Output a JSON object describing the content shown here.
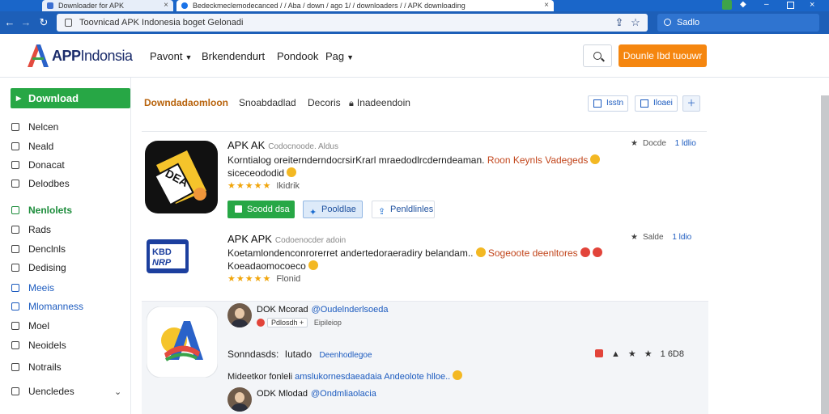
{
  "browser": {
    "tabs": [
      {
        "title": "Downloader for APK"
      },
      {
        "title": "Bedeckmeclemodecanced / / Aba / down / ago 1/ / downloaders / / APK downloading"
      }
    ],
    "url": "Toovnicad APK Indonesia boget Gelonadi",
    "search_placeholder": "Sadlo"
  },
  "site": {
    "logo": {
      "bold": "APP",
      "light": "Indonsia"
    },
    "nav": [
      {
        "label": "Pavont",
        "caret": true
      },
      {
        "label": "Brkendendurt",
        "caret": false
      },
      {
        "label": "Pondook",
        "caret": false
      },
      {
        "label": "Pag",
        "caret": true
      }
    ],
    "cta_label": "Dounle Ibd tuouwr"
  },
  "sidebar": {
    "download_label": "Download",
    "items": [
      {
        "label": "Nelcen",
        "style": "normal"
      },
      {
        "label": "Neald",
        "style": "normal"
      },
      {
        "label": "Donacat",
        "style": "normal"
      },
      {
        "label": "Delodbes",
        "style": "normal"
      },
      {
        "label": "Nenlolets",
        "style": "green"
      },
      {
        "label": "Rads",
        "style": "normal"
      },
      {
        "label": "Denclnls",
        "style": "normal"
      },
      {
        "label": "Dedising",
        "style": "normal"
      },
      {
        "label": "Meeis",
        "style": "blue"
      },
      {
        "label": "Mlomanness",
        "style": "blue"
      },
      {
        "label": "Moel",
        "style": "normal"
      },
      {
        "label": "Neoidels",
        "style": "normal"
      },
      {
        "label": "Notrails",
        "style": "normal"
      },
      {
        "label": "Uencledes",
        "style": "normal"
      }
    ]
  },
  "main": {
    "tabs": [
      {
        "label": "Downdadaomloon",
        "active": true
      },
      {
        "label": "Snoabdadlad",
        "active": false
      },
      {
        "label": "Decoris",
        "active": false
      },
      {
        "label": "Inadeendoin",
        "active": false
      }
    ],
    "view_buttons": [
      "Isstn",
      "Iloaei",
      ""
    ],
    "apps": [
      {
        "title": "APK AK",
        "subtitle": "Codocnoode. Aldus",
        "desc_line1": "Korntialog oreiternderndocrsirKrarl mraedodlrcderndeaman.",
        "desc_highlight": "Roon Keynls Vadegeds",
        "desc_line2": "siceceododid",
        "rating": 4.5,
        "rating_label": "Ikidrik",
        "meta_left": "Docde",
        "meta_right": "1 ldlio",
        "actions": [
          "Soodd dsa",
          "Pooldlae",
          "Penldlinles"
        ]
      },
      {
        "title": "APK APK",
        "subtitle": "Codoenocder adoin",
        "desc_line1": "Koetamlondenconrorerret andertedoraeradiry belandam..",
        "desc_highlight": "Sogeoote deenltores",
        "desc_line2": "Koeadaomocoeco",
        "rating": 4.5,
        "rating_label": "Flonid",
        "meta_left": "Salde",
        "meta_right": "1 ldio"
      }
    ],
    "comments": [
      {
        "name": "DOK Mcorad",
        "handle": "@Oudelnderlsoeda",
        "badge": "Pdlosdh",
        "badge_extra": "Eipileiop"
      },
      {
        "heading_a": "Sonndasds:",
        "heading_b": "Iutado",
        "heading_c": "Deenhodlegoe",
        "text": "Mideetkor fonleli",
        "text_link": "amslukornesdaeadaia Andeolote hlloe..",
        "tools_count": "1 6D8"
      },
      {
        "name": "ODK Mlodad",
        "handle": "@Ondmliaolacia"
      }
    ]
  }
}
